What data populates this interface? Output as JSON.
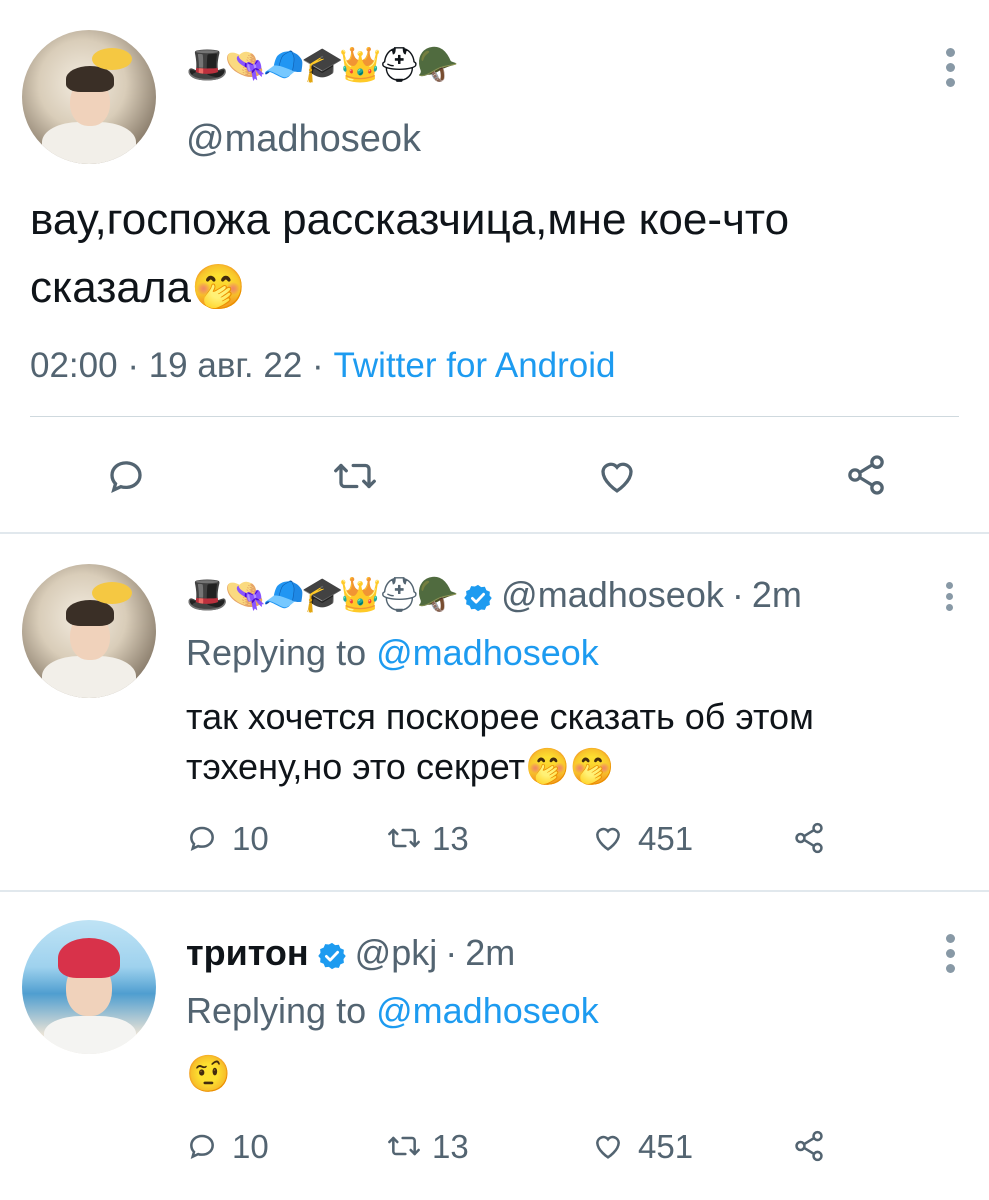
{
  "main_tweet": {
    "name_emojis": "🎩👒🧢🎓👑⛑🪖",
    "handle": "@madhoseok",
    "text": "вау,госпожа рассказчица,мне кое-что сказала🤭",
    "time": "02:00",
    "date": "19 авг. 22",
    "source": "Twitter for Android",
    "separator": "·"
  },
  "replies": [
    {
      "name_emojis": "🎩👒🧢🎓👑⛑🪖",
      "handle": "@madhoseok",
      "age": "2m",
      "replying_label": "Replying to",
      "replying_handle": "@madhoseok",
      "text": "так хочется поскорее сказать об этом тэхену,но это секрет🤭🤭",
      "replies": "10",
      "retweets": "13",
      "likes": "451"
    },
    {
      "name": "тритон",
      "handle": "@pkj",
      "age": "2m",
      "replying_label": "Replying to",
      "replying_handle": "@madhoseok",
      "text": "🤨",
      "replies": "10",
      "retweets": "13",
      "likes": "451"
    }
  ],
  "colors": {
    "link": "#1d9bf0",
    "muted": "#536471",
    "text": "#0f1419",
    "verified": "#1d9bf0"
  },
  "icons": [
    "reply-icon",
    "retweet-icon",
    "like-icon",
    "share-icon",
    "more-icon",
    "verified-badge-icon"
  ]
}
